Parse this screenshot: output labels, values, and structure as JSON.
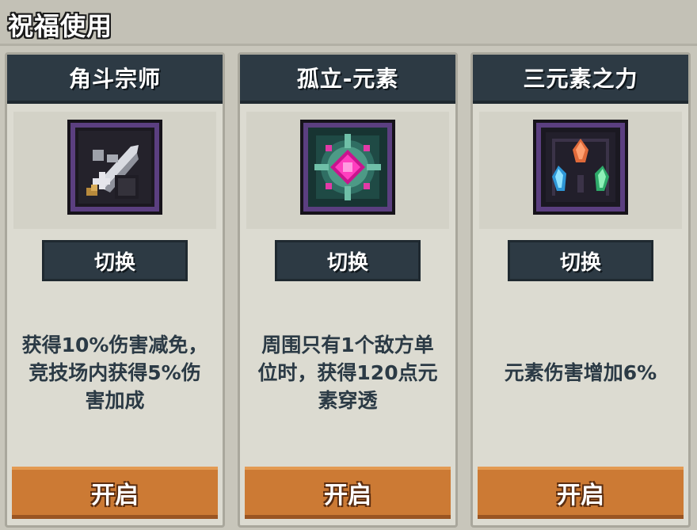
{
  "header": {
    "title": "祝福使用"
  },
  "cards": [
    {
      "title": "角斗宗师",
      "icon": "gladiator-sword-icon",
      "switch_label": "切换",
      "description": "获得10%伤害减免，\n竞技场内获得5%伤\n害加成",
      "open_label": "开启"
    },
    {
      "title": "孤立-元素",
      "icon": "isolated-element-gem-icon",
      "switch_label": "切换",
      "description": "周围只有1个敌方单\n位时，获得120点元\n素穿透",
      "open_label": "开启"
    },
    {
      "title": "三元素之力",
      "icon": "three-elements-crystals-icon",
      "switch_label": "切换",
      "description": "元素伤害增加6%",
      "open_label": "开启"
    }
  ],
  "colors": {
    "panel_dark": "#2d3a44",
    "button_orange": "#cc7a34",
    "icon_frame_purple": "#5b3f80",
    "description_text": "#2b3a45"
  }
}
